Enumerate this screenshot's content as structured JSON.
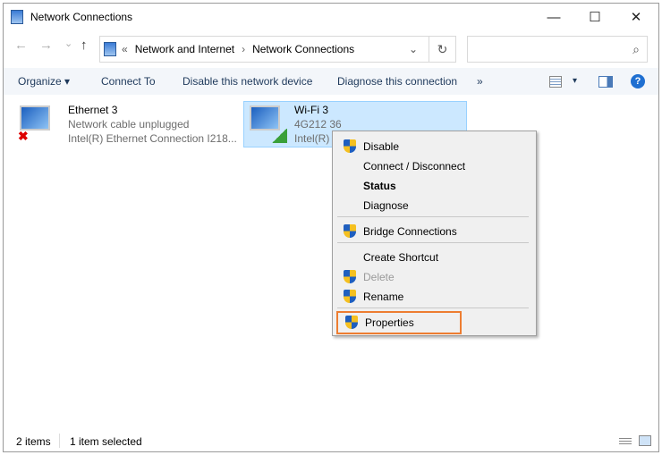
{
  "window": {
    "title": "Network Connections",
    "minimize": "—",
    "maximize": "☐",
    "close": "✕"
  },
  "nav": {
    "back": "←",
    "forward": "→",
    "recent": "⌄",
    "up": "↑",
    "breadcrumb_prefix": "«",
    "breadcrumb": [
      "Network and Internet",
      "Network Connections"
    ],
    "separator": "›",
    "dropdown": "⌄",
    "refresh": "↻",
    "search_placeholder": "",
    "search_icon": "⌕"
  },
  "toolbar": {
    "organize": "Organize ▾",
    "connect_to": "Connect To",
    "disable": "Disable this network device",
    "diagnose": "Diagnose this connection",
    "more": "»",
    "view_icon": "view-options-icon",
    "view_dropdown": "▾",
    "help": "?"
  },
  "connections": [
    {
      "name": "Ethernet 3",
      "status": "Network cable unplugged",
      "device": "Intel(R) Ethernet Connection I218..."
    },
    {
      "name": "Wi-Fi 3",
      "status": "4G212 36",
      "device": "Intel(R)"
    }
  ],
  "context_menu": [
    {
      "label": "Disable",
      "shield": true
    },
    {
      "label": "Connect / Disconnect",
      "shield": false
    },
    {
      "label": "Status",
      "shield": false,
      "bold": true
    },
    {
      "label": "Diagnose",
      "shield": false
    },
    {
      "label": "Bridge Connections",
      "shield": true
    },
    {
      "label": "Create Shortcut",
      "shield": false
    },
    {
      "label": "Delete",
      "shield": true,
      "disabled": true
    },
    {
      "label": "Rename",
      "shield": true
    },
    {
      "label": "Properties",
      "shield": true,
      "highlighted": true
    }
  ],
  "statusbar": {
    "count": "2 items",
    "selected": "1 item selected"
  },
  "colors": {
    "highlight": "#ed7d31",
    "selection": "#cce8ff",
    "help": "#1f6fd1"
  }
}
